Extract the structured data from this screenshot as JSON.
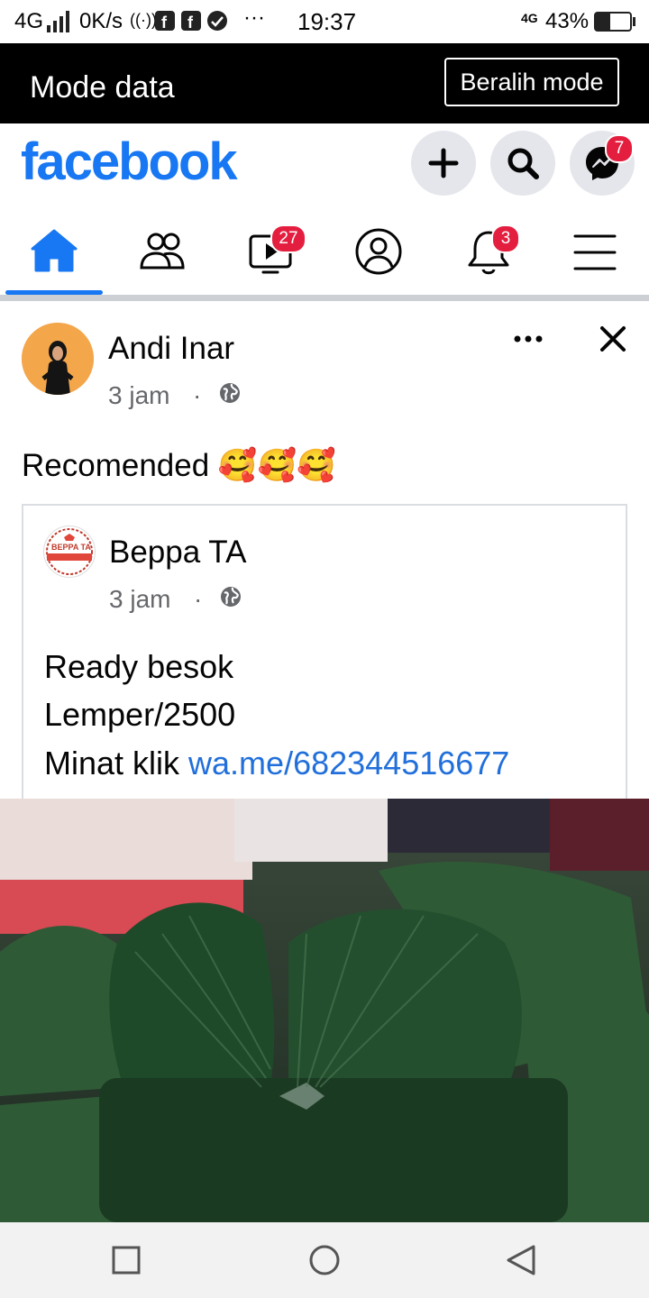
{
  "status_bar": {
    "network": "4G",
    "speed": "0K/s",
    "time": "19:37",
    "right_network": "4G",
    "battery": "43%",
    "battery_level": 0.43
  },
  "data_mode": {
    "title": "Mode data",
    "switch_button": "Beralih mode"
  },
  "header": {
    "logo": "facebook",
    "messenger_badge": "7"
  },
  "nav": {
    "watch_badge": "27",
    "notifications_badge": "3"
  },
  "post": {
    "author": "Andi Inar",
    "time": "3 jam",
    "separator": "·",
    "text": "Recomended 🥰🥰🥰",
    "shared": {
      "author": "Beppa TA",
      "avatar_text": "BEPPA TA",
      "time": "3 jam",
      "separator": "·",
      "line1": "Ready besok",
      "line2": "Lemper/2500",
      "line3_prefix": "Minat klik ",
      "line3_link": "wa.me/682344516677"
    }
  },
  "colors": {
    "brand": "#1877f2",
    "badge": "#e41e3f",
    "link": "#216fdb"
  }
}
